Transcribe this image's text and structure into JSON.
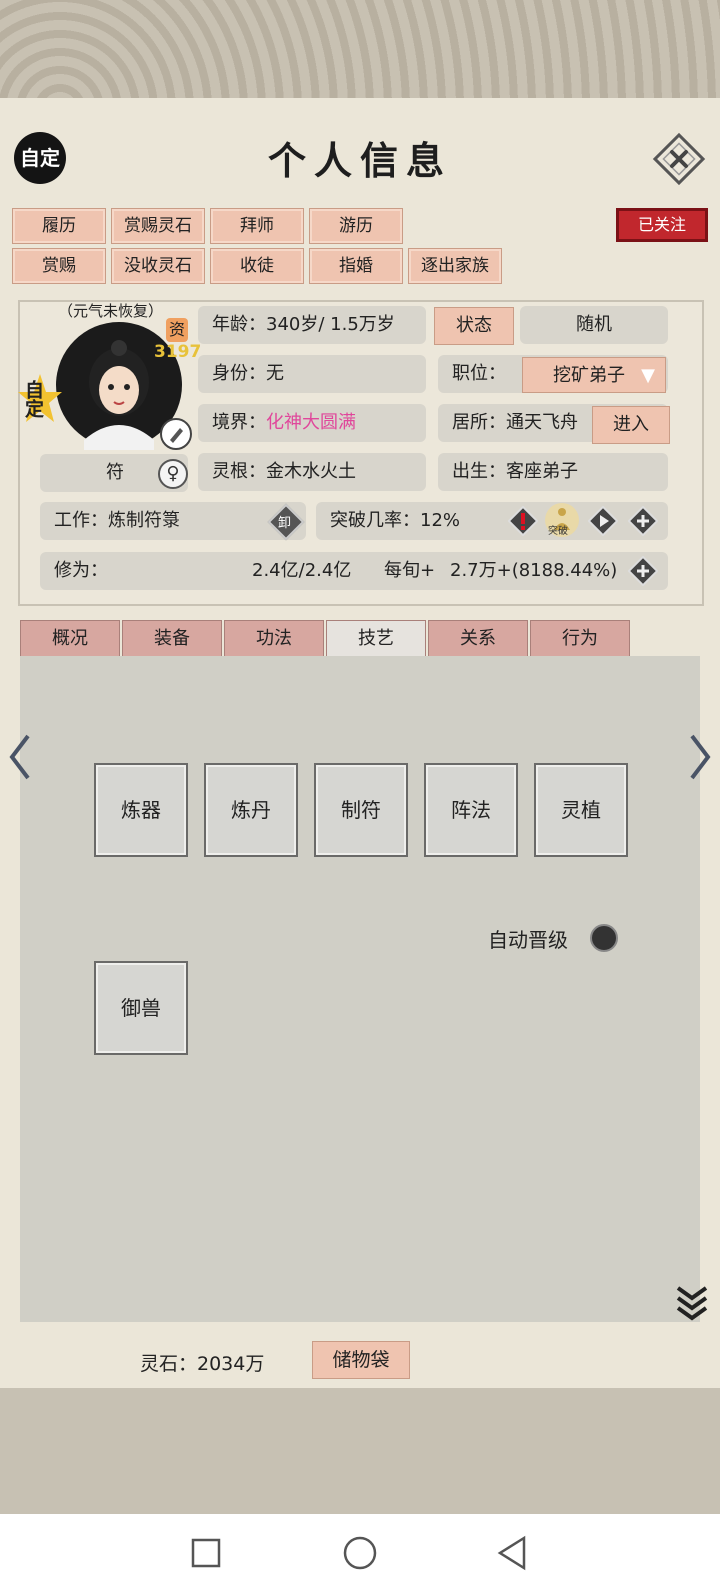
{
  "header": {
    "custom_badge": "自定",
    "title": "个人信息"
  },
  "actions_row1": [
    "履历",
    "赏赐灵石",
    "拜师",
    "游历"
  ],
  "actions_row2": [
    "赏赐",
    "没收灵石",
    "收徒",
    "指婚",
    "逐出家族"
  ],
  "follow_label": "已关注",
  "avatar": {
    "status_note": "（元气未恢复）",
    "aptitude_label": "资",
    "aptitude_value": "3197",
    "custom_star": "自定"
  },
  "info": {
    "age_label": "年龄：",
    "age_value": "340岁/ 1.5万岁",
    "state_button": "状态",
    "random_button": "随机",
    "identity_label": "身份：",
    "identity_value": "无",
    "position_label": "职位：",
    "position_value": "挖矿弟子",
    "realm_label": "境界：",
    "realm_value": "化神大圆满",
    "residence_label": "居所：",
    "residence_value": "通天飞舟",
    "enter_button": "进入",
    "talisman": "符",
    "gender_symbol": "♀",
    "root_label": "灵根：",
    "root_value": "金木水火土",
    "birth_label": "出生：",
    "birth_value": "客座弟子",
    "work_label": "工作：",
    "work_value": "炼制符箓",
    "unload_label": "卸",
    "breakthrough_label": "突破几率：",
    "breakthrough_value": "12%",
    "breakthrough_icon_text": "突破",
    "cultivation_label": "修为：",
    "cultivation_value": "2.4亿/2.4亿",
    "per_turn_label": "每旬+",
    "per_turn_value": "2.7万+(8188.44%)"
  },
  "tabs": [
    "概况",
    "装备",
    "功法",
    "技艺",
    "关系",
    "行为"
  ],
  "active_tab": "技艺",
  "skills_row1": [
    "炼器",
    "炼丹",
    "制符",
    "阵法",
    "灵植"
  ],
  "auto_upgrade_label": "自动晋级",
  "skills_row2": [
    "御兽"
  ],
  "footer": {
    "spirit_stone": "灵石：2034万",
    "storage_bag": "储物袋"
  },
  "colors": {
    "accent_red": "#c1272d",
    "tab_pink": "#d7a7a0",
    "realm_pink": "#e0479b"
  }
}
